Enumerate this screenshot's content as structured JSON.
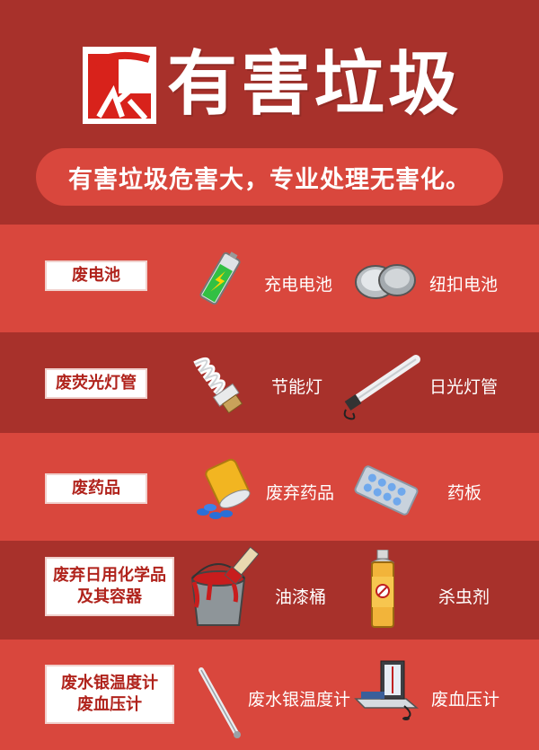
{
  "header": {
    "title": "有害垃圾",
    "slogan": "有害垃圾危害大，专业处理无害化。"
  },
  "categories": [
    {
      "name": "废电池",
      "items": [
        "充电电池",
        "纽扣电池"
      ]
    },
    {
      "name": "废荧光灯管",
      "items": [
        "节能灯",
        "日光灯管"
      ]
    },
    {
      "name": "废药品",
      "items": [
        "废弃药品",
        "药板"
      ]
    },
    {
      "name_line1": "废弃日用化学品",
      "name_line2": "及其容器",
      "items": [
        "油漆桶",
        "杀虫剂"
      ]
    },
    {
      "name_line1": "废水银温度计",
      "name_line2": "废血压计",
      "items": [
        "废水银温度计",
        "废血压计"
      ]
    }
  ],
  "colors": {
    "dark_red": "#a8312b",
    "light_red": "#d9473d",
    "white": "#ffffff",
    "category_text": "#b0231c"
  },
  "icons": [
    "logo",
    "rechargeable-battery-icon",
    "button-battery-icon",
    "energy-saving-bulb-icon",
    "fluorescent-tube-icon",
    "medicine-bottle-icon",
    "blister-pack-icon",
    "paint-bucket-icon",
    "insecticide-can-icon",
    "thermometer-icon",
    "blood-pressure-monitor-icon"
  ]
}
